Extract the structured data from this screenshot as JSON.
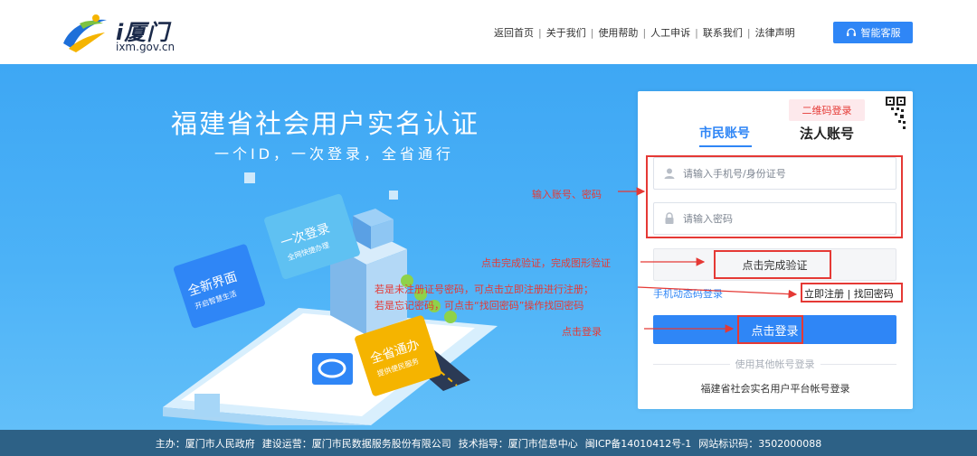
{
  "header": {
    "logo_title": "i厦门",
    "logo_domain": "ixm.gov.cn",
    "nav": [
      "返回首页",
      "关于我们",
      "使用帮助",
      "人工申诉",
      "联系我们",
      "法律声明"
    ],
    "service_button": "智能客服"
  },
  "hero": {
    "title": "福建省社会用户实名认证",
    "subtitle": "一个ID，一次登录，全省通行",
    "illustration": {
      "sign_new": "全新界面",
      "sign_new_sub": "开启智慧生活",
      "sign_once": "一次登录",
      "sign_once_sub": "全网快捷办理",
      "sign_province": "全省通办",
      "sign_province_sub": "提供便民服务"
    }
  },
  "login": {
    "qr_tip": "二维码登录",
    "tabs": [
      "市民账号",
      "法人账号"
    ],
    "active_tab": "市民账号",
    "account_placeholder": "请输入手机号/身份证号",
    "password_placeholder": "请输入密码",
    "verify_button": "点击完成验证",
    "sms_link": "手机动态码登录",
    "register_link": "立即注册",
    "divider_bar": "|",
    "forgot_link": "找回密码",
    "login_button": "点击登录",
    "other_accounts": "使用其他帐号登录",
    "platform_login": "福建省社会实名用户平台帐号登录"
  },
  "annotations": {
    "account_note": "输入账号、密码",
    "verify_note": "点击完成验证，完成图形验证",
    "register_note_1": "若是未注册证号密码，可点击立即注册进行注册；",
    "register_note_2": "若是忘记密码，可点击“找回密码”操作找回密码",
    "login_note": "点击登录",
    "accent": "#e53935"
  },
  "footer": {
    "sponsor": "主办：厦门市人民政府",
    "operator": "建设运营：厦门市民数据服务股份有限公司",
    "tech": "技术指导：厦门市信息中心",
    "icp": "闽ICP备14010412号-1",
    "site_code": "网站标识码：3502000088"
  },
  "colors": {
    "primary": "#2f86f6",
    "hero_bg": "#45aef6",
    "footer_bg": "#2d6186"
  }
}
